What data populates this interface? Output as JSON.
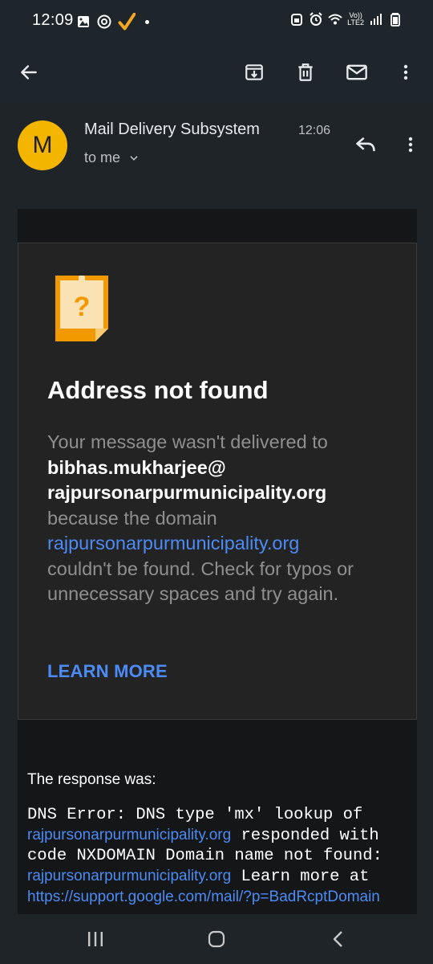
{
  "status_bar": {
    "time": "12:09",
    "network_label_top": "Vo))",
    "network_label_bottom": "LTE2",
    "icons": [
      "image-icon",
      "chrome-icon",
      "check-icon",
      "dot-icon",
      "alarm-lock-icon",
      "alarm-icon",
      "wifi-icon",
      "signal-icon",
      "battery-icon"
    ]
  },
  "toolbar": {
    "icons": [
      "back-arrow-icon",
      "archive-icon",
      "delete-icon",
      "mark-unread-icon",
      "more-vert-icon"
    ]
  },
  "header": {
    "avatar_letter": "M",
    "sender": "Mail Delivery Subsystem",
    "time": "12:06",
    "to": "to me",
    "avatar_color": "#f3b500"
  },
  "card": {
    "title": "Address not found",
    "text_intro": "Your message wasn't delivered to",
    "recipient_line1": "bibhas.mukharjee@",
    "recipient_line2": "rajpursonarpurmunicipality.org",
    "text_because": "because the domain",
    "domain_link": "rajpursonarpurmunicipality.org",
    "text_rest": "couldn't be found. Check for typos or unnecessary spaces and try again.",
    "learn_more": "LEARN MORE"
  },
  "response": {
    "label": "The response was:",
    "part1": "DNS Error: DNS type 'mx' lookup of ",
    "link1": "rajpursonarpurmunicipality.org",
    "part2": " responded with code NXDOMAIN Domain name not found: ",
    "link2": "rajpursonarpurmunicipality.org",
    "part3": " Learn more at ",
    "link3": "https://support.google.com/mail/?p=BadRcptDomain"
  },
  "colors": {
    "accent_link": "#4c8bf5",
    "background": "#1f2428",
    "card_background": "#232323"
  }
}
